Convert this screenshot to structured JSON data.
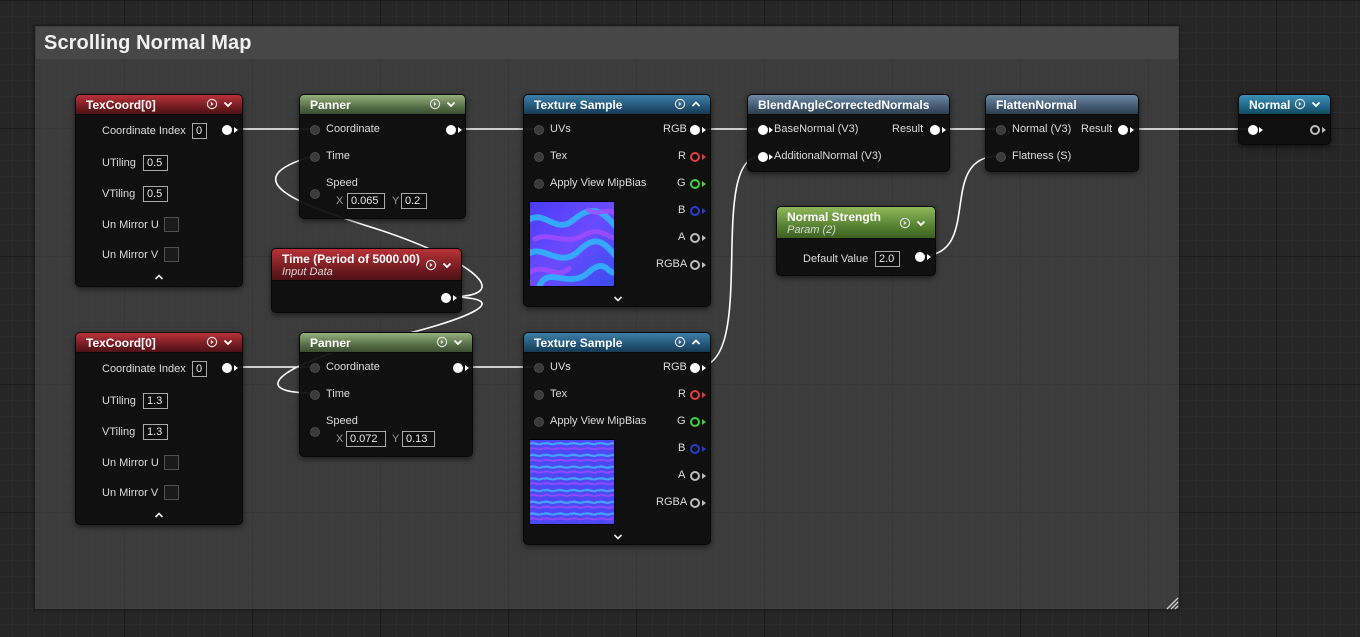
{
  "comment": {
    "title": "Scrolling Normal Map"
  },
  "texcoord_1": {
    "title": "TexCoord[0]",
    "coordinate_index_label": "Coordinate Index",
    "coordinate_index_value": "0",
    "utiling_label": "UTiling",
    "utiling_value": "0.5",
    "vtiling_label": "VTiling",
    "vtiling_value": "0.5",
    "un_mirror_u_label": "Un Mirror U",
    "un_mirror_v_label": "Un Mirror V"
  },
  "texcoord_2": {
    "title": "TexCoord[0]",
    "coordinate_index_label": "Coordinate Index",
    "coordinate_index_value": "0",
    "utiling_label": "UTiling",
    "utiling_value": "1.3",
    "vtiling_label": "VTiling",
    "vtiling_value": "1.3",
    "un_mirror_u_label": "Un Mirror U",
    "un_mirror_v_label": "Un Mirror V"
  },
  "panner_1": {
    "title": "Panner",
    "coordinate_label": "Coordinate",
    "time_label": "Time",
    "speed_label": "Speed",
    "x_label": "X",
    "x_value": "0.065",
    "y_label": "Y",
    "y_value": "0.2"
  },
  "panner_2": {
    "title": "Panner",
    "coordinate_label": "Coordinate",
    "time_label": "Time",
    "speed_label": "Speed",
    "x_label": "X",
    "x_value": "0.072",
    "y_label": "Y",
    "y_value": "0.13"
  },
  "time_node": {
    "title": "Time (Period of 5000.00)",
    "subtitle": "Input Data"
  },
  "texture_sample_1": {
    "title": "Texture Sample",
    "uvs_label": "UVs",
    "tex_label": "Tex",
    "mip_label": "Apply View MipBias",
    "rgb_label": "RGB",
    "r_label": "R",
    "g_label": "G",
    "b_label": "B",
    "a_label": "A",
    "rgba_label": "RGBA"
  },
  "texture_sample_2": {
    "title": "Texture Sample",
    "uvs_label": "UVs",
    "tex_label": "Tex",
    "mip_label": "Apply View MipBias",
    "rgb_label": "RGB",
    "r_label": "R",
    "g_label": "G",
    "b_label": "B",
    "a_label": "A",
    "rgba_label": "RGBA"
  },
  "blend_node": {
    "title": "BlendAngleCorrectedNormals",
    "base_normal_label": "BaseNormal (V3)",
    "result_label": "Result",
    "additional_normal_label": "AdditionalNormal (V3)"
  },
  "flatten_node": {
    "title": "FlattenNormal",
    "normal_label": "Normal (V3)",
    "result_label": "Result",
    "flatness_label": "Flatness (S)"
  },
  "normal_strength": {
    "title": "Normal Strength",
    "subtitle": "Param (2)",
    "default_value_label": "Default Value",
    "default_value": "2.0"
  },
  "reroute_node": {
    "title": "Normal"
  },
  "colors": {
    "header_red": "#b93239",
    "header_green": "#94b07a",
    "header_blue": "#3d7ea6",
    "header_steel": "#6e8aa6",
    "header_lime": "#8fb85a",
    "header_cyan": "#3c90b7",
    "wire": "#ffffff",
    "pin_r": "#e23d3d",
    "pin_g": "#3ed13e",
    "pin_b": "#2a3bd6"
  }
}
